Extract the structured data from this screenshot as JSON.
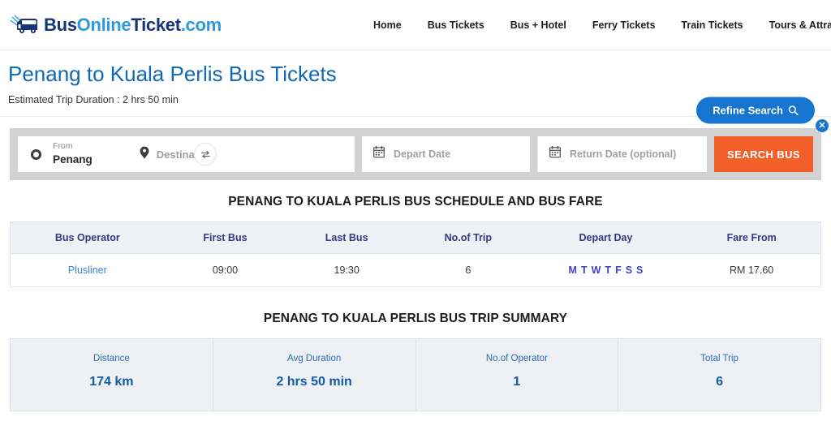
{
  "header": {
    "logo": {
      "icon": "bus-logo-icon",
      "part1": "Bus",
      "part2": "Online",
      "part3": "Ticket",
      "part4": ".com"
    },
    "nav": [
      {
        "label": "Home"
      },
      {
        "label": "Bus Tickets"
      },
      {
        "label": "Bus + Hotel"
      },
      {
        "label": "Ferry Tickets"
      },
      {
        "label": "Train Tickets"
      },
      {
        "label": "Tours & Attractions"
      }
    ]
  },
  "title_bar": {
    "page_title": "Penang to Kuala Perlis Bus Tickets",
    "trip_duration": "Estimated Trip Duration : 2 hrs 50 min",
    "refine_button": "Refine Search"
  },
  "search": {
    "from_label": "From",
    "from_value": "Penang",
    "destination_placeholder": "Destination",
    "depart_date_placeholder": "Depart Date",
    "return_date_placeholder": "Return Date (optional)",
    "search_button": "SEARCH BUS",
    "close_label": "✕"
  },
  "schedule": {
    "heading": "PENANG TO KUALA PERLIS BUS SCHEDULE AND BUS FARE",
    "columns": [
      "Bus Operator",
      "First Bus",
      "Last Bus",
      "No.of Trip",
      "Depart Day",
      "Fare From"
    ],
    "rows": [
      {
        "operator": "Plusliner",
        "first_bus": "09:00",
        "last_bus": "19:30",
        "no_of_trip": "6",
        "depart_days": [
          "M",
          "T",
          "W",
          "T",
          "F",
          "S",
          "S"
        ],
        "fare_from": "RM 17.60"
      }
    ]
  },
  "summary": {
    "heading": "PENANG TO KUALA PERLIS BUS TRIP SUMMARY",
    "cells": [
      {
        "label": "Distance",
        "value": "174 km"
      },
      {
        "label": "Avg Duration",
        "value": "2 hrs 50 min"
      },
      {
        "label": "No.of Operator",
        "value": "1"
      },
      {
        "label": "Total Trip",
        "value": "6"
      }
    ]
  },
  "colors": {
    "brand_dark": "#15347a",
    "brand_light": "#2c9ade",
    "title_blue": "#1168b3",
    "accent_orange": "#f4602a",
    "button_blue": "#1675cf",
    "table_header_text": "#343a7f",
    "day_blue": "#3f3fd0"
  }
}
